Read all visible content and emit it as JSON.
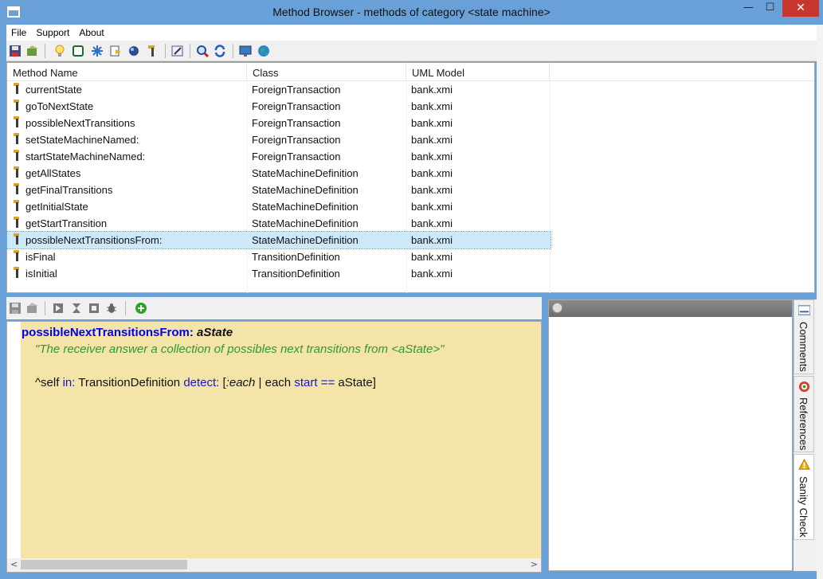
{
  "window": {
    "title": "Method Browser - methods of category <state machine>",
    "close_symbol": "✕",
    "min_symbol": "—",
    "max_symbol": "☐"
  },
  "menu": {
    "items": [
      "File",
      "Support",
      "About"
    ]
  },
  "toolbar": {
    "icons": [
      "save-icon",
      "open-icon",
      "lightbulb-icon",
      "square-icon",
      "snowflake-icon",
      "bookmark-icon",
      "globe-icon",
      "method-icon",
      "edit-icon",
      "search-icon",
      "refresh-icon",
      "monitor-icon",
      "earth-icon"
    ]
  },
  "method_list": {
    "columns": [
      "Method Name",
      "Class",
      "UML Model"
    ],
    "rows": [
      {
        "name": "currentState",
        "class": "ForeignTransaction",
        "model": "bank.xmi"
      },
      {
        "name": "goToNextState",
        "class": "ForeignTransaction",
        "model": "bank.xmi"
      },
      {
        "name": "possibleNextTransitions",
        "class": "ForeignTransaction",
        "model": "bank.xmi"
      },
      {
        "name": "setStateMachineNamed:",
        "class": "ForeignTransaction",
        "model": "bank.xmi"
      },
      {
        "name": "startStateMachineNamed:",
        "class": "ForeignTransaction",
        "model": "bank.xmi"
      },
      {
        "name": "getAllStates",
        "class": "StateMachineDefinition",
        "model": "bank.xmi"
      },
      {
        "name": "getFinalTransitions",
        "class": "StateMachineDefinition",
        "model": "bank.xmi"
      },
      {
        "name": "getInitialState",
        "class": "StateMachineDefinition",
        "model": "bank.xmi"
      },
      {
        "name": "getStartTransition",
        "class": "StateMachineDefinition",
        "model": "bank.xmi"
      },
      {
        "name": "possibleNextTransitionsFrom:",
        "class": "StateMachineDefinition",
        "model": "bank.xmi"
      },
      {
        "name": "isFinal",
        "class": "TransitionDefinition",
        "model": "bank.xmi"
      },
      {
        "name": "isInitial",
        "class": "TransitionDefinition",
        "model": "bank.xmi"
      }
    ],
    "selected_index": 9
  },
  "editor": {
    "selector": "possibleNextTransitionsFrom:",
    "argument": "aState",
    "comment": "\"The receiver answer a collection of possibles next transitions from <aState>\"",
    "code": {
      "t1": "^self ",
      "k1": "in:",
      "t2": " TransitionDefinition ",
      "k2": "detect:",
      "t3": " [",
      "i1": ":each",
      "t4": " | each ",
      "k3": "start",
      "t5": " ",
      "k4": "==",
      "t6": " aState]"
    }
  },
  "side_tabs": {
    "comments": "Comments",
    "references": "References",
    "sanity": "Sanity Check"
  },
  "colors": {
    "titlebar": "#6aa0d8",
    "editor_bg": "#f5e4a7",
    "selection": "#cde8f8",
    "keyword": "#1515d0",
    "comment": "#2f9a2f"
  }
}
